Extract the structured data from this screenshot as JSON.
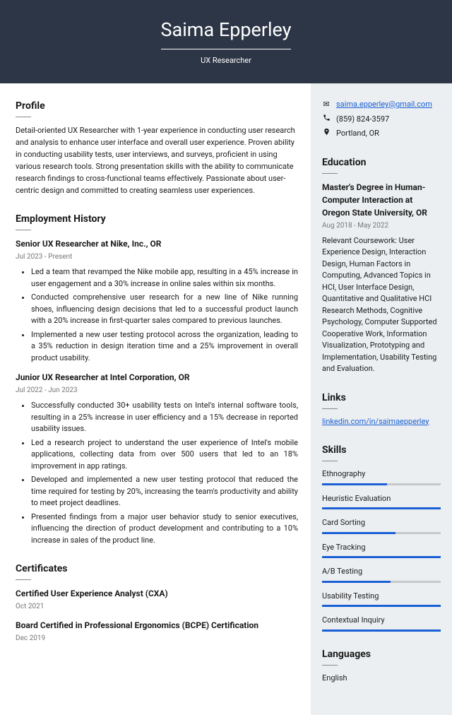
{
  "header": {
    "name": "Saima Epperley",
    "title": "UX Researcher"
  },
  "profile": {
    "heading": "Profile",
    "text": "Detail-oriented UX Researcher with 1-year experience in conducting user research and analysis to enhance user interface and overall user experience. Proven ability in conducting usability tests, user interviews, and surveys, proficient in using various research tools. Strong presentation skills with the ability to communicate research findings to cross-functional teams effectively. Passionate about user-centric design and committed to creating seamless user experiences."
  },
  "employment": {
    "heading": "Employment History",
    "jobs": [
      {
        "title": "Senior UX Researcher at Nike, Inc., OR",
        "dates": "Jul 2023 - Present",
        "bullets": [
          "Led a team that revamped the Nike mobile app, resulting in a 45% increase in user engagement and a 30% increase in online sales within six months.",
          "Conducted comprehensive user research for a new line of Nike running shoes, influencing design decisions that led to a successful product launch with a 20% increase in first-quarter sales compared to previous launches.",
          "Implemented a new user testing protocol across the organization, leading to a 35% reduction in design iteration time and a 25% improvement in overall product usability."
        ]
      },
      {
        "title": "Junior UX Researcher at Intel Corporation, OR",
        "dates": "Jul 2022 - Jun 2023",
        "bullets": [
          "Successfully conducted 30+ usability tests on Intel's internal software tools, resulting in a 25% increase in user efficiency and a 15% decrease in reported usability issues.",
          "Led a research project to understand the user experience of Intel's mobile applications, collecting data from over 500 users that led to an 18% improvement in app ratings.",
          "Developed and implemented a new user testing protocol that reduced the time required for testing by 20%, increasing the team's productivity and ability to meet project deadlines.",
          "Presented findings from a major user behavior study to senior executives, influencing the direction of product development and contributing to a 10% increase in sales of the product line."
        ]
      }
    ]
  },
  "certificates": {
    "heading": "Certificates",
    "items": [
      {
        "title": "Certified User Experience Analyst (CXA)",
        "date": "Oct 2021"
      },
      {
        "title": "Board Certified in Professional Ergonomics (BCPE) Certification",
        "date": "Dec 2019"
      }
    ]
  },
  "contact": {
    "email": "saima.epperley@gmail.com",
    "phone": "(859) 824-3597",
    "location": "Portland, OR"
  },
  "education": {
    "heading": "Education",
    "degree": "Master's Degree in Human-Computer Interaction at Oregon State University, OR",
    "dates": "Aug 2018 - May 2022",
    "coursework": "Relevant Coursework: User Experience Design, Interaction Design, Human Factors in Computing, Advanced Topics in HCI, User Interface Design, Quantitative and Qualitative HCI Research Methods, Cognitive Psychology, Computer Supported Cooperative Work, Information Visualization, Prototyping and Implementation, Usability Testing and Evaluation."
  },
  "links": {
    "heading": "Links",
    "items": [
      "linkedin.com/in/saimaepperley"
    ]
  },
  "skills": {
    "heading": "Skills",
    "items": [
      {
        "name": "Ethnography",
        "pct": 55
      },
      {
        "name": "Heuristic Evaluation",
        "pct": 100
      },
      {
        "name": "Card Sorting",
        "pct": 62
      },
      {
        "name": "Eye Tracking",
        "pct": 100
      },
      {
        "name": "A/B Testing",
        "pct": 58
      },
      {
        "name": "Usability Testing",
        "pct": 100
      },
      {
        "name": "Contextual Inquiry",
        "pct": 100
      }
    ]
  },
  "languages": {
    "heading": "Languages",
    "items": [
      "English"
    ]
  }
}
